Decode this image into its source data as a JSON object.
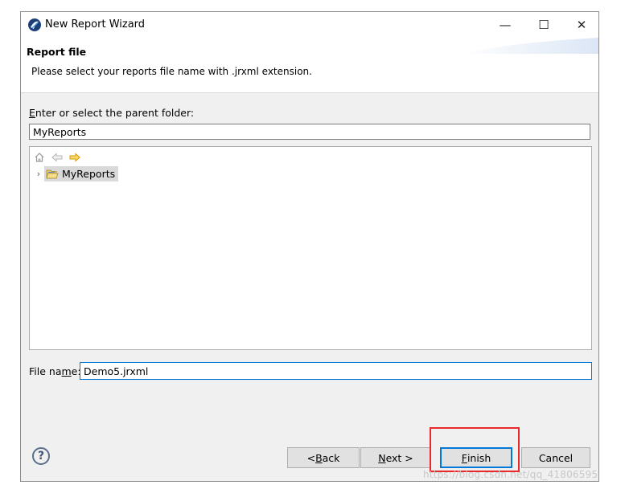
{
  "window": {
    "title": "New Report Wizard",
    "min_symbol": "—",
    "max_symbol": "☐",
    "close_symbol": "✕"
  },
  "header": {
    "title": "Report file",
    "description": "Please select your reports file name with .jrxml extension."
  },
  "folder": {
    "label_key": "E",
    "label_rest": "nter or select the parent folder:",
    "value": "MyReports"
  },
  "tree": {
    "toolbar": [
      "home-icon",
      "back-arrow-icon",
      "forward-arrow-icon"
    ],
    "items": [
      {
        "label": "MyReports",
        "icon": "open-folder-icon",
        "selected": true
      }
    ]
  },
  "file_name": {
    "label_pre": "File na",
    "label_key": "m",
    "label_post": "e:",
    "value": "Demo5.jrxml"
  },
  "buttons": {
    "help": "?",
    "back_pre": "< ",
    "back_key": "B",
    "back_post": "ack",
    "next_key": "N",
    "next_post": "ext >",
    "finish_key": "F",
    "finish_post": "inish",
    "cancel": "Cancel"
  },
  "colors": {
    "accent": "#0078d7",
    "highlight": "#e8282b"
  },
  "watermark": "https://blog.csdn.net/qq_41806595"
}
